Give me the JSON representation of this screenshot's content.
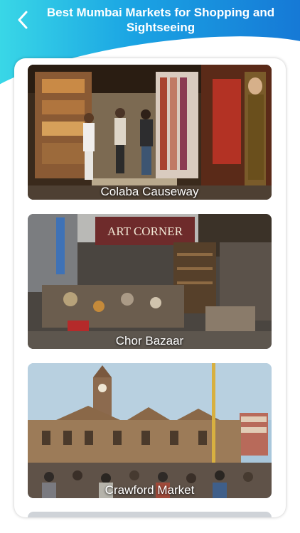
{
  "header": {
    "title": "Best Mumbai Markets for Shopping and Sightseeing"
  },
  "markets": [
    {
      "name": "Colaba Causeway"
    },
    {
      "name": "Chor Bazaar",
      "sign": "ART CORNER"
    },
    {
      "name": "Crawford Market"
    }
  ],
  "colors": {
    "header_gradient_start": "#39d7e7",
    "header_gradient_end": "#1679d6",
    "card_background": "#ffffff"
  }
}
